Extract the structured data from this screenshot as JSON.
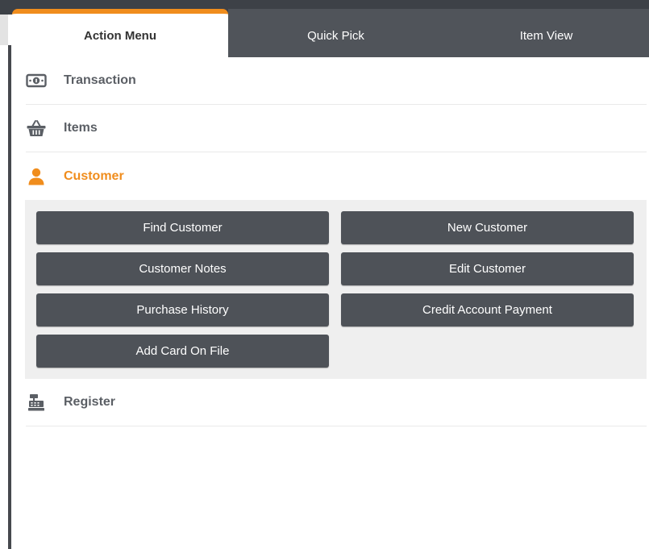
{
  "tabs": [
    {
      "label": "Action Menu"
    },
    {
      "label": "Quick Pick"
    },
    {
      "label": "Item View"
    }
  ],
  "active_tab": "Action Menu",
  "accent_color": "#f08d1d",
  "menu": {
    "transaction": {
      "label": "Transaction",
      "icon": "cash-icon"
    },
    "items": {
      "label": "Items",
      "icon": "basket-icon"
    },
    "customer": {
      "label": "Customer",
      "icon": "person-icon",
      "expanded": true,
      "actions": [
        {
          "label": "Find Customer"
        },
        {
          "label": "New Customer"
        },
        {
          "label": "Customer Notes"
        },
        {
          "label": "Edit Customer"
        },
        {
          "label": "Purchase History"
        },
        {
          "label": "Credit Account Payment"
        },
        {
          "label": "Add Card On File"
        }
      ]
    },
    "register": {
      "label": "Register",
      "icon": "cash-register-icon"
    }
  }
}
